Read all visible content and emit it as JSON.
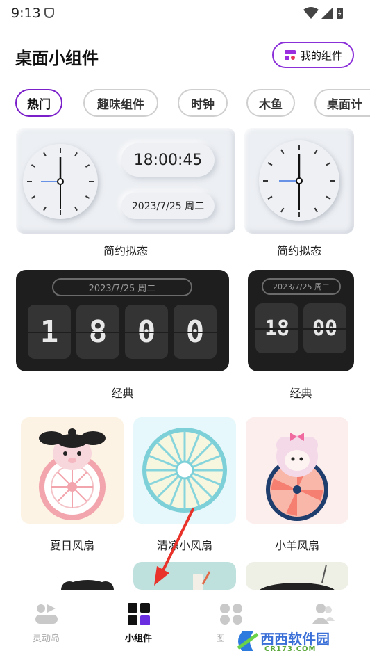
{
  "status": {
    "time": "9:13"
  },
  "header": {
    "title": "桌面小组件",
    "my_widgets_label": "我的组件"
  },
  "tabs": [
    "热门",
    "趣味组件",
    "时钟",
    "木鱼",
    "桌面计"
  ],
  "cards": {
    "simple_large": {
      "time": "18:00:45",
      "date": "2023/7/25 周二",
      "caption": "简约拟态"
    },
    "simple_small": {
      "caption": "简约拟态"
    },
    "classic_large": {
      "date": "2023/7/25 周二",
      "digits": [
        "1",
        "8",
        "0",
        "0"
      ],
      "caption": "经典"
    },
    "classic_small": {
      "date": "2023/7/25 周二",
      "digits": [
        "18",
        "00"
      ],
      "caption": "经典"
    },
    "fan1": {
      "caption": "夏日风扇"
    },
    "fan2": {
      "caption": "清凉小风扇"
    },
    "fan3": {
      "caption": "小羊风扇"
    }
  },
  "nav": [
    "灵动岛",
    "小组件",
    "图",
    ""
  ],
  "watermark": {
    "text": "西西软件园",
    "sub": "CR173.COM"
  },
  "colors": {
    "accent": "#7a1fc9",
    "arrow": "#e8322a"
  }
}
